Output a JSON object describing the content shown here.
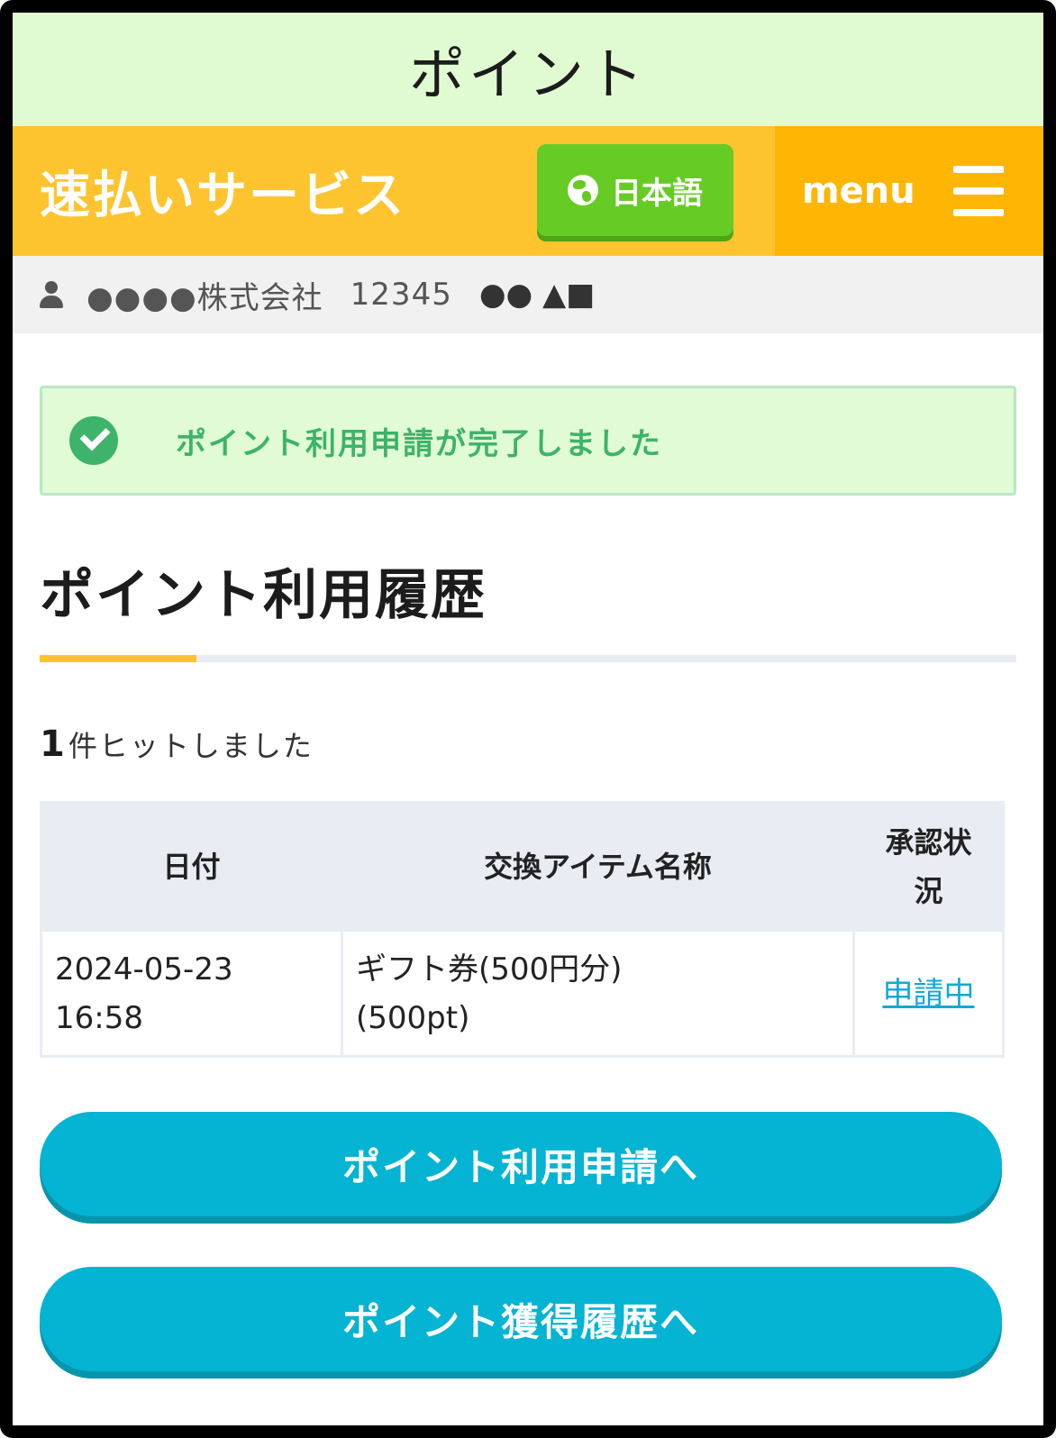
{
  "titlebar": {
    "title": "ポイント"
  },
  "header": {
    "brand": "速払いサービス",
    "language_button": "日本語",
    "menu_label": "menu"
  },
  "userbar": {
    "company": "●●●●株式会社",
    "user_id": "12345",
    "user_name": "●● ▲■"
  },
  "alert": {
    "message": "ポイント利用申請が完了しました"
  },
  "section": {
    "title": "ポイント利用履歴"
  },
  "result": {
    "count": "1",
    "suffix": "件ヒットしました"
  },
  "table": {
    "headers": {
      "date": "日付",
      "item": "交換アイテム名称",
      "status_line1": "承認状",
      "status_line2": "況"
    },
    "rows": [
      {
        "date_line1": "2024-05-23",
        "date_line2": "16:58",
        "item_line1": "ギフト券(500円分)",
        "item_line2": "(500pt)",
        "status": "申請中"
      }
    ]
  },
  "buttons": {
    "apply": "ポイント利用申請へ",
    "earned_history": "ポイント獲得履歴へ"
  },
  "colors": {
    "titlebar_bg": "#e0fbd2",
    "header_bg": "#fec42f",
    "menu_bg": "#feb503",
    "lang_button_bg": "#67cb25",
    "success_green": "#3db36b",
    "button_bg": "#05b3d3",
    "link_color": "#12a8d8"
  },
  "icons": {
    "language": "globe-icon",
    "menu": "hamburger-icon",
    "user": "user-icon",
    "alert": "check-circle-icon"
  }
}
